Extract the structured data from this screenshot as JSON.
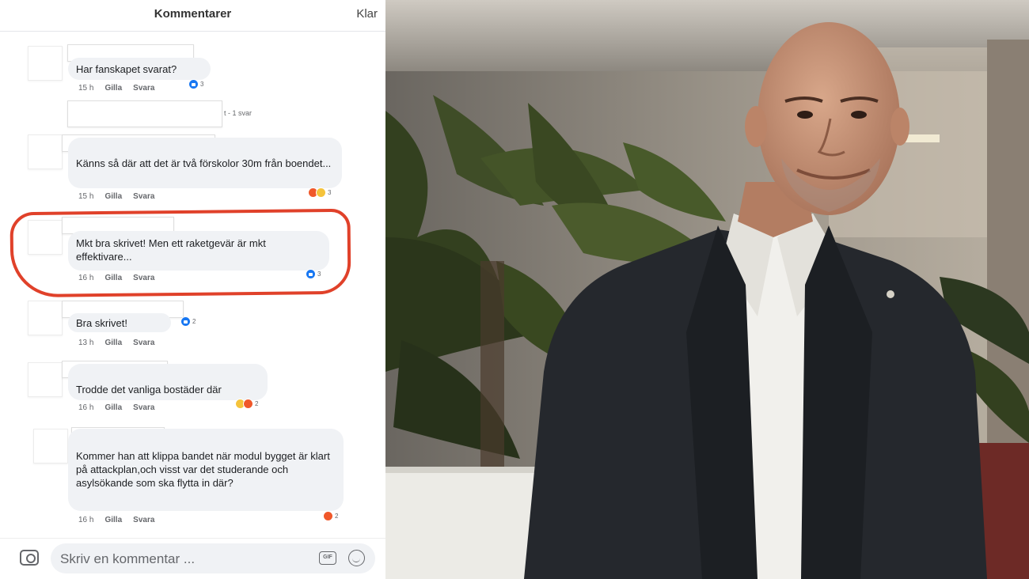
{
  "header": {
    "title": "Kommentarer",
    "done_label": "Klar"
  },
  "hidden_reply": {
    "text": "t - 1 svar"
  },
  "comments": [
    {
      "text": "Har fanskapet svarat?",
      "time": "15 h",
      "like": "Gilla",
      "reply": "Svara",
      "reaction_count": "3"
    },
    {
      "text": "Känns så där att det är två förskolor 30m från boendet...",
      "time": "15 h",
      "like": "Gilla",
      "reply": "Svara",
      "reaction_count": "3"
    },
    {
      "text": "Mkt bra skrivet! Men ett raketgevär är mkt effektivare...",
      "time": "16 h",
      "like": "Gilla",
      "reply": "Svara",
      "reaction_count": "3"
    },
    {
      "text": "Bra skrivet!",
      "time": "13 h",
      "like": "Gilla",
      "reply": "Svara",
      "reaction_count": "2"
    },
    {
      "text": "Trodde det vanliga bostäder där",
      "time": "16 h",
      "like": "Gilla",
      "reply": "Svara",
      "reaction_count": "2"
    },
    {
      "text": "Kommer han att klippa bandet när modul bygget är klart på attackplan,och visst var det studerande och asylsökande som ska flytta in där?",
      "time": "16 h",
      "like": "Gilla",
      "reply": "Svara",
      "reaction_count": "2"
    }
  ],
  "composer": {
    "placeholder": "Skriv en kommentar ...",
    "gif_label": "GIF"
  },
  "icons": {
    "camera": "camera-icon",
    "gif": "gif-icon",
    "emoji": "smile-icon",
    "like_reaction": "like-reaction-icon",
    "angry_reaction": "angry-reaction-icon",
    "haha_reaction": "haha-reaction-icon"
  },
  "colors": {
    "highlight": "#e0412a",
    "like": "#1877f2",
    "bubble": "#f0f2f5"
  }
}
